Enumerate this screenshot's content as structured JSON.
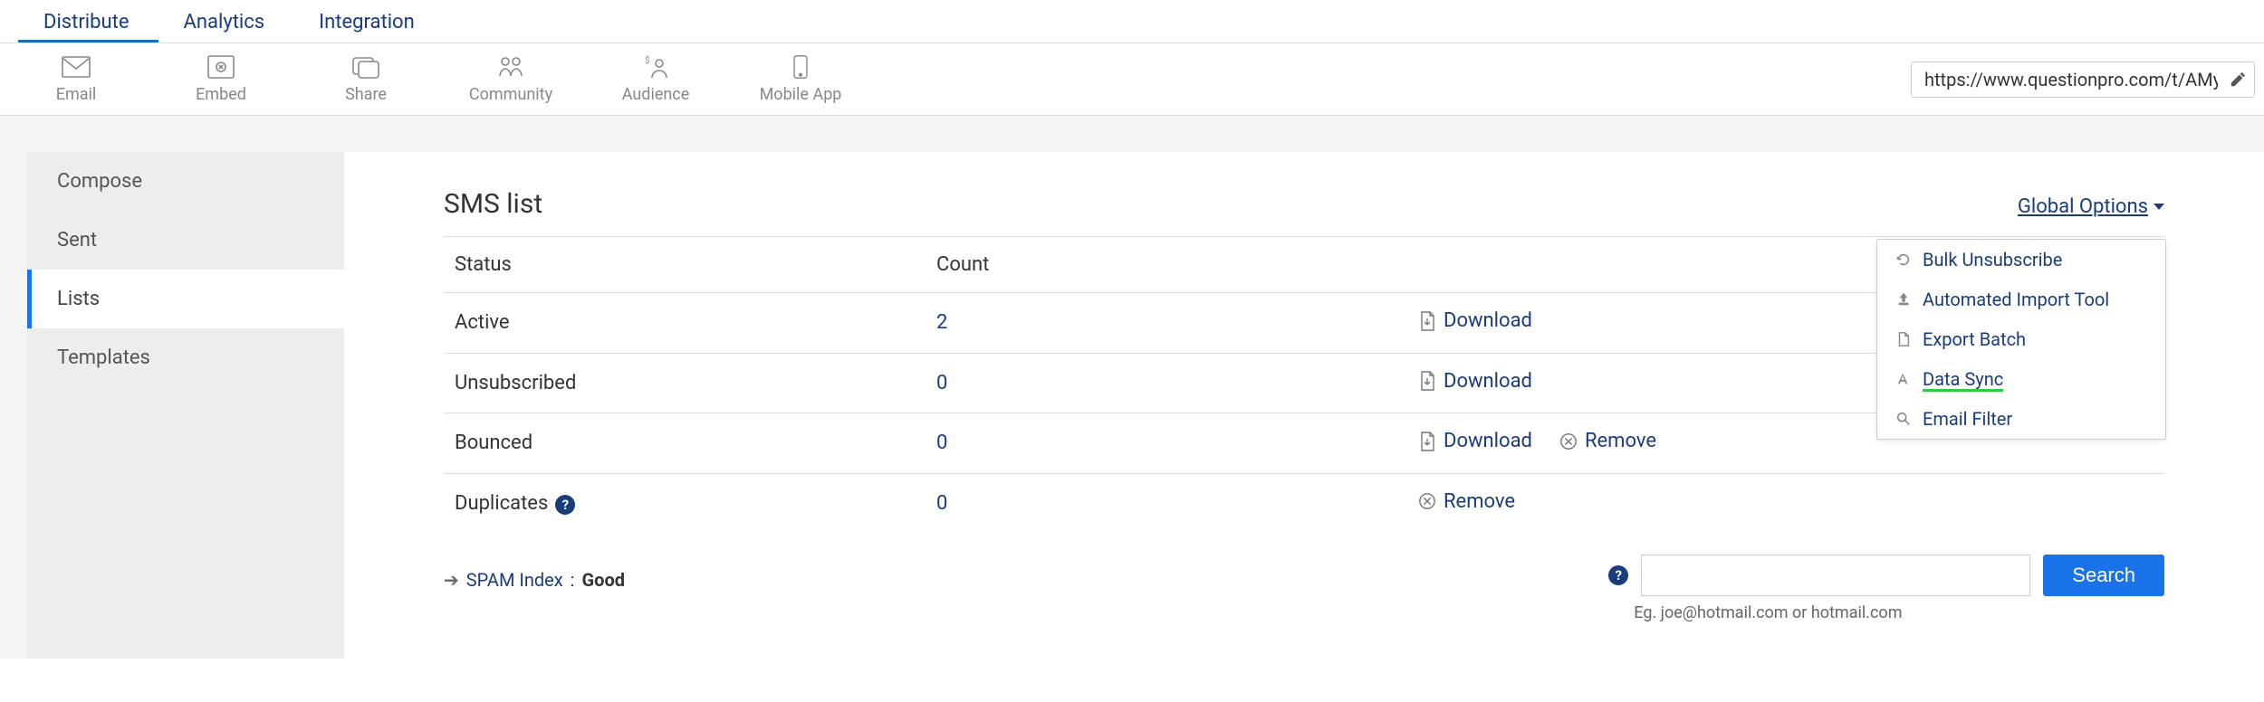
{
  "topnav": {
    "tabs": [
      {
        "label": "Distribute",
        "active": true
      },
      {
        "label": "Analytics",
        "active": false
      },
      {
        "label": "Integration",
        "active": false
      }
    ]
  },
  "toolbar": {
    "items": [
      {
        "label": "Email",
        "icon": "envelope"
      },
      {
        "label": "Embed",
        "icon": "embed"
      },
      {
        "label": "Share",
        "icon": "share"
      },
      {
        "label": "Community",
        "icon": "community"
      },
      {
        "label": "Audience",
        "icon": "audience"
      },
      {
        "label": "Mobile App",
        "icon": "mobile"
      }
    ],
    "url_value": "https://www.questionpro.com/t/AMy"
  },
  "sidebar": {
    "items": [
      {
        "label": "Compose",
        "active": false
      },
      {
        "label": "Sent",
        "active": false
      },
      {
        "label": "Lists",
        "active": true
      },
      {
        "label": "Templates",
        "active": false
      }
    ]
  },
  "page": {
    "title": "SMS list",
    "global_options_label": "Global Options",
    "dropdown": [
      {
        "label": "Bulk Unsubscribe",
        "icon": "undo"
      },
      {
        "label": "Automated Import Tool",
        "icon": "upload"
      },
      {
        "label": "Export Batch",
        "icon": "file"
      },
      {
        "label": "Data Sync",
        "icon": "font",
        "highlight": true
      },
      {
        "label": "Email Filter",
        "icon": "search"
      }
    ],
    "table": {
      "headers": {
        "status": "Status",
        "count": "Count"
      },
      "rows": [
        {
          "status": "Active",
          "count": "2",
          "actions": [
            "download"
          ]
        },
        {
          "status": "Unsubscribed",
          "count": "0",
          "actions": [
            "download"
          ]
        },
        {
          "status": "Bounced",
          "count": "0",
          "actions": [
            "download",
            "remove"
          ]
        },
        {
          "status": "Duplicates",
          "count": "0",
          "help": true,
          "actions": [
            "remove"
          ]
        }
      ]
    },
    "action_labels": {
      "download": "Download",
      "remove": "Remove"
    },
    "spam": {
      "link": "SPAM Index",
      "sep": " : ",
      "value": "Good"
    },
    "search": {
      "placeholder": "",
      "button": "Search",
      "hint": "Eg. joe@hotmail.com or hotmail.com"
    }
  }
}
